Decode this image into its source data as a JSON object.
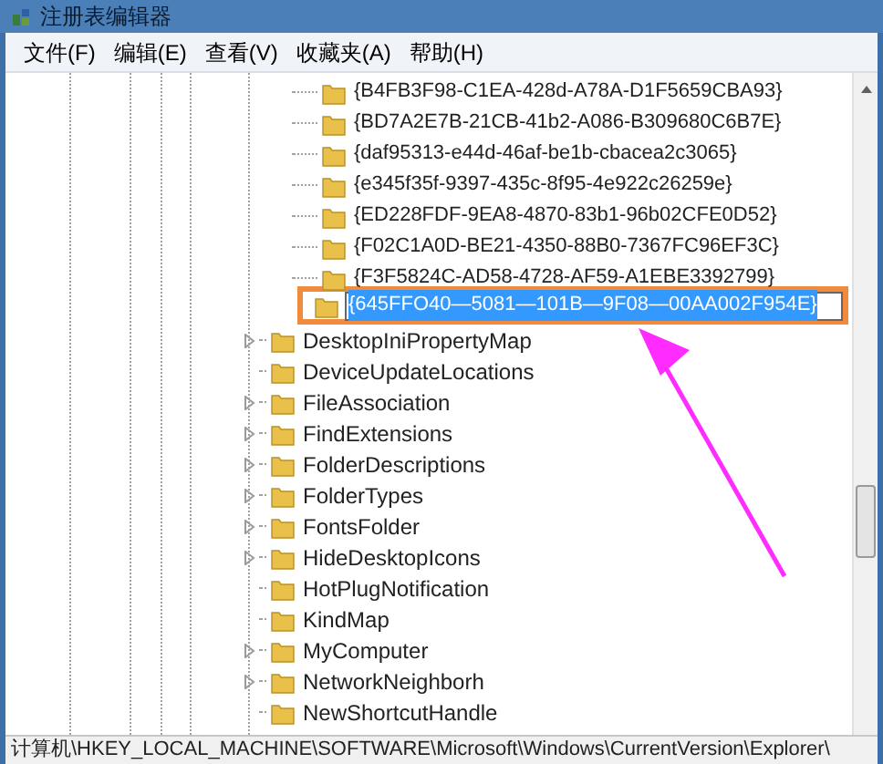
{
  "window": {
    "title": "注册表编辑器"
  },
  "menu": [
    "文件(F)",
    "编辑(E)",
    "查看(V)",
    "收藏夹(A)",
    "帮助(H)"
  ],
  "guid_keys": [
    {
      "label": "{B4FB3F98-C1EA-428d-A78A-D1F5659CBA93}"
    },
    {
      "label": "{BD7A2E7B-21CB-41b2-A086-B309680C6B7E}"
    },
    {
      "label": "{daf95313-e44d-46af-be1b-cbacea2c3065}"
    },
    {
      "label": "{e345f35f-9397-435c-8f95-4e922c26259e}"
    },
    {
      "label": "{ED228FDF-9EA8-4870-83b1-96b02CFE0D52}"
    },
    {
      "label": "{F02C1A0D-BE21-4350-88B0-7367FC96EF3C}"
    },
    {
      "label": "{F3F5824C-AD58-4728-AF59-A1EBE3392799}"
    }
  ],
  "editing_key": {
    "value": "{645FFO40—5081—101B—9F08—00AA002F954E}",
    "highlighted": true
  },
  "keys": [
    {
      "label": "DesktopIniPropertyMap",
      "expandable": true
    },
    {
      "label": "DeviceUpdateLocations",
      "expandable": false
    },
    {
      "label": "FileAssociation",
      "expandable": true
    },
    {
      "label": "FindExtensions",
      "expandable": true
    },
    {
      "label": "FolderDescriptions",
      "expandable": true
    },
    {
      "label": "FolderTypes",
      "expandable": true
    },
    {
      "label": "FontsFolder",
      "expandable": true
    },
    {
      "label": "HideDesktopIcons",
      "expandable": true
    },
    {
      "label": "HotPlugNotification",
      "expandable": false
    },
    {
      "label": "KindMap",
      "expandable": false
    },
    {
      "label": "MyComputer",
      "expandable": true
    },
    {
      "label": "NetworkNeighborh",
      "expandable": true
    },
    {
      "label": "NewShortcutHandle",
      "expandable": false
    }
  ],
  "status_bar": "计算机\\HKEY_LOCAL_MACHINE\\SOFTWARE\\Microsoft\\Windows\\CurrentVersion\\Explorer\\"
}
